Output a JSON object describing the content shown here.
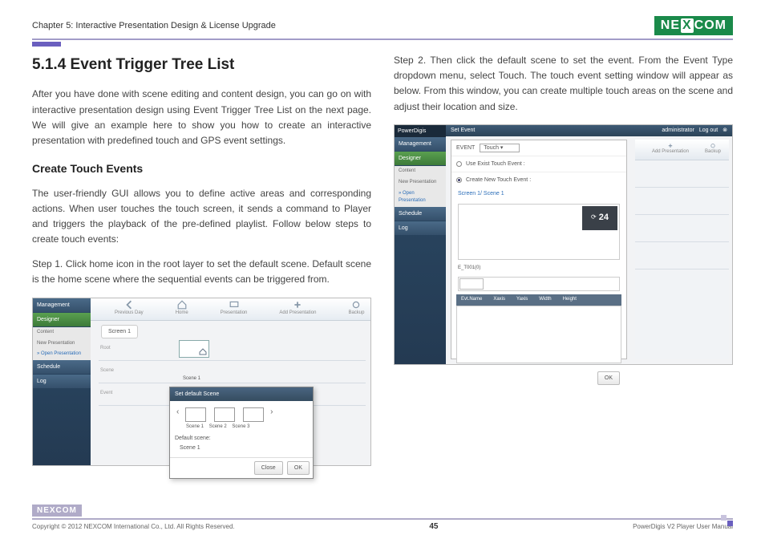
{
  "header": {
    "chapter": "Chapter 5: Interactive Presentation Design & License Upgrade",
    "logo_text_left": "NE",
    "logo_text_x": "X",
    "logo_text_right": "COM"
  },
  "left_col": {
    "section_title": "5.1.4 Event Trigger Tree List",
    "intro": "After you have done with scene editing and content design, you can go on with interactive presentation design using Event Trigger Tree List on the next page. We will give an example here to show you how to create an interactive presentation with predefined touch and GPS event settings.",
    "sub_title": "Create Touch Events",
    "para2": "The user-friendly GUI allows you to define active areas and corresponding actions. When user touches the touch screen, it sends a command to Player and triggers the playback of the pre-defined playlist. Follow below steps to create touch events:",
    "step1": "Step 1. Click home icon in the root layer to set the default scene. Default scene is the home scene where the sequential events can be triggered from."
  },
  "right_col": {
    "step2": "Step 2. Then click the default scene to set the event. From the Event Type dropdown menu, select Touch. The touch event setting window will appear as below. From this window, you can create multiple touch areas on the scene and adjust their location and size."
  },
  "shot1": {
    "sidebar": {
      "management": "Management",
      "designer": "Designer",
      "content": "Content",
      "new_presentation": "New Presentation",
      "open_presentation": "» Open Presentation",
      "schedule": "Schedule",
      "log": "Log"
    },
    "topbar": {
      "prev": "Previous Day",
      "home": "Home",
      "presentation": "Presentation",
      "add": "Add Presentation",
      "backup": "Backup"
    },
    "tab": "Screen 1",
    "rows": {
      "root": "Root",
      "scene": "Scene",
      "event": "Event"
    },
    "box_label": "Scene 1",
    "dialog": {
      "title": "Set default Scene",
      "scene1": "Scene 1",
      "scene2": "Scene 2",
      "scene3": "Scene 3",
      "default_label": "Default scene:",
      "default_value": "Scene 1",
      "close": "Close",
      "ok": "OK"
    }
  },
  "shot2": {
    "brand": "PowerDigis",
    "topbar_title": "Set Event",
    "admin": "administrator",
    "logout": "Log out",
    "sidebar": {
      "management": "Management",
      "designer": "Designer",
      "content": "Content",
      "new_presentation": "New Presentation",
      "open_presentation": "» Open Presentation",
      "schedule": "Schedule",
      "log": "Log"
    },
    "event_label": "EVENT",
    "event_value": "Touch",
    "radio1": "Use Exist Touch Event :",
    "radio2": "Create New Touch Event :",
    "scene_path": "Screen 1/ Scene 1",
    "num": "24",
    "tname": "E_T001(0)",
    "cols": {
      "c1": "Evt.Name",
      "c2": "Xaxis",
      "c3": "Yaxis",
      "c4": "Width",
      "c5": "Height"
    },
    "ok": "OK",
    "right_icons": {
      "add": "Add Presentation",
      "backup": "Backup"
    }
  },
  "footer": {
    "logo": "NEXCOM",
    "copyright": "Copyright © 2012 NEXCOM International Co., Ltd. All Rights Reserved.",
    "page": "45",
    "manual": "PowerDigis V2 Player User Manual"
  }
}
